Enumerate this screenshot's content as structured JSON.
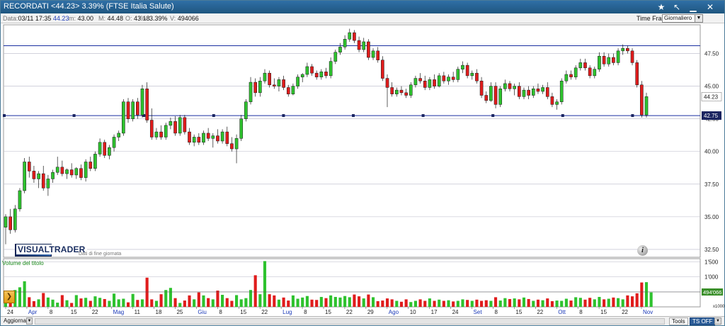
{
  "window": {
    "title": "RECORDATI <44.23> 3.39%   (FTSE Italia Salute)",
    "colors": {
      "titlebar": "#2f6fa6"
    }
  },
  "info_bar": {
    "date_label": "Data:",
    "date_value": "03/11 17:35",
    "last_value": "44.23",
    "min_label": "m:",
    "min_value": "43.00",
    "max_label": "M:",
    "max_value": "44.48",
    "open_label": "O:",
    "open_value": "43.18",
    "pct_label": "%:",
    "pct_value": "3.39%",
    "vol_label": "V:",
    "vol_value": "494066",
    "time_frame_label": "Time Frame",
    "time_frame_value": "Giornaliero"
  },
  "chart_data": {
    "type": "candlestick",
    "price_axis": {
      "range": [
        31.9,
        49.7
      ],
      "ticks": [
        "32.50",
        "35.00",
        "37.50",
        "40.00",
        "42.50",
        "45.00",
        "47.50"
      ]
    },
    "resistance_line": 48.1,
    "support_line": 42.75,
    "current_price_label": "44.23",
    "support_price_label": "42.75",
    "volume_title": "Volume del titolo",
    "volume_axis": {
      "range": [
        0,
        1600
      ],
      "ticks": [
        {
          "value": 1500,
          "label": "1'500"
        },
        {
          "value": 1000,
          "label": "1'000"
        },
        {
          "value": 500,
          "label": "500"
        }
      ],
      "unit": "x1000",
      "current_label": "494'066",
      "current_value": 494
    },
    "x_axis": {
      "labels": [
        "24",
        "Apr",
        "8",
        "15",
        "22",
        "Mag",
        "11",
        "18",
        "25",
        "Giu",
        "8",
        "15",
        "22",
        "Lug",
        "8",
        "15",
        "22",
        "29",
        "Ago",
        "10",
        "17",
        "24",
        "Set",
        "8",
        "15",
        "22",
        "Ott",
        "8",
        "15",
        "22",
        "Nov"
      ],
      "highlighted": [
        "Apr",
        "Mag",
        "Giu",
        "Lug",
        "Ago",
        "Set",
        "Ott",
        "Nov"
      ]
    },
    "colors": {
      "up": "#2ec22e",
      "down": "#e01c1c",
      "grid": "#b8b8c8",
      "level_line": "#1a2fa0"
    },
    "candles": [
      {
        "o": 34.2,
        "h": 35.2,
        "l": 32.9,
        "c": 35.0
      },
      {
        "o": 35.0,
        "h": 35.6,
        "l": 33.7,
        "c": 34.0
      },
      {
        "o": 34.0,
        "h": 35.9,
        "l": 33.8,
        "c": 35.6
      },
      {
        "o": 35.6,
        "h": 37.2,
        "l": 35.4,
        "c": 37.0
      },
      {
        "o": 37.0,
        "h": 39.5,
        "l": 36.8,
        "c": 39.2
      },
      {
        "o": 39.2,
        "h": 39.6,
        "l": 38.0,
        "c": 38.5
      },
      {
        "o": 38.5,
        "h": 38.9,
        "l": 37.6,
        "c": 37.9
      },
      {
        "o": 37.9,
        "h": 38.5,
        "l": 37.2,
        "c": 38.3
      },
      {
        "o": 38.3,
        "h": 38.9,
        "l": 37.0,
        "c": 37.2
      },
      {
        "o": 37.2,
        "h": 38.2,
        "l": 36.6,
        "c": 37.9
      },
      {
        "o": 37.9,
        "h": 38.6,
        "l": 37.6,
        "c": 38.4
      },
      {
        "o": 38.4,
        "h": 39.6,
        "l": 38.2,
        "c": 38.8
      },
      {
        "o": 38.8,
        "h": 39.3,
        "l": 38.1,
        "c": 38.3
      },
      {
        "o": 38.3,
        "h": 38.7,
        "l": 37.9,
        "c": 38.6
      },
      {
        "o": 38.6,
        "h": 39.1,
        "l": 38.0,
        "c": 38.2
      },
      {
        "o": 38.2,
        "h": 38.8,
        "l": 37.9,
        "c": 38.7
      },
      {
        "o": 38.7,
        "h": 39.0,
        "l": 37.8,
        "c": 38.0
      },
      {
        "o": 38.0,
        "h": 39.4,
        "l": 37.7,
        "c": 39.2
      },
      {
        "o": 39.2,
        "h": 39.6,
        "l": 38.5,
        "c": 38.7
      },
      {
        "o": 38.7,
        "h": 40.0,
        "l": 38.5,
        "c": 39.8
      },
      {
        "o": 39.8,
        "h": 41.0,
        "l": 39.6,
        "c": 40.7
      },
      {
        "o": 40.7,
        "h": 40.9,
        "l": 39.5,
        "c": 39.7
      },
      {
        "o": 39.7,
        "h": 40.5,
        "l": 39.4,
        "c": 40.3
      },
      {
        "o": 40.3,
        "h": 41.3,
        "l": 40.0,
        "c": 41.1
      },
      {
        "o": 41.1,
        "h": 41.6,
        "l": 40.8,
        "c": 41.4
      },
      {
        "o": 41.4,
        "h": 44.0,
        "l": 41.2,
        "c": 43.8
      },
      {
        "o": 43.8,
        "h": 44.1,
        "l": 42.2,
        "c": 42.5
      },
      {
        "o": 42.5,
        "h": 44.0,
        "l": 42.3,
        "c": 43.8
      },
      {
        "o": 43.8,
        "h": 44.1,
        "l": 42.5,
        "c": 42.8
      },
      {
        "o": 42.8,
        "h": 45.1,
        "l": 42.6,
        "c": 44.8
      },
      {
        "o": 44.8,
        "h": 45.3,
        "l": 42.2,
        "c": 42.4
      },
      {
        "o": 42.4,
        "h": 43.3,
        "l": 40.9,
        "c": 41.1
      },
      {
        "o": 41.1,
        "h": 41.8,
        "l": 40.9,
        "c": 41.5
      },
      {
        "o": 41.5,
        "h": 42.0,
        "l": 40.9,
        "c": 41.1
      },
      {
        "o": 41.1,
        "h": 42.2,
        "l": 40.9,
        "c": 42.0
      },
      {
        "o": 42.0,
        "h": 42.6,
        "l": 41.7,
        "c": 42.3
      },
      {
        "o": 42.3,
        "h": 42.7,
        "l": 41.2,
        "c": 41.4
      },
      {
        "o": 41.4,
        "h": 42.8,
        "l": 41.2,
        "c": 42.6
      },
      {
        "o": 42.6,
        "h": 42.8,
        "l": 41.3,
        "c": 41.5
      },
      {
        "o": 41.5,
        "h": 41.8,
        "l": 40.5,
        "c": 40.7
      },
      {
        "o": 40.7,
        "h": 41.3,
        "l": 40.4,
        "c": 41.1
      },
      {
        "o": 41.1,
        "h": 41.4,
        "l": 40.5,
        "c": 40.7
      },
      {
        "o": 40.7,
        "h": 41.6,
        "l": 40.5,
        "c": 41.4
      },
      {
        "o": 41.4,
        "h": 41.8,
        "l": 40.8,
        "c": 41.0
      },
      {
        "o": 41.0,
        "h": 41.4,
        "l": 40.3,
        "c": 41.2
      },
      {
        "o": 41.2,
        "h": 41.7,
        "l": 40.6,
        "c": 40.8
      },
      {
        "o": 40.8,
        "h": 41.7,
        "l": 40.6,
        "c": 41.5
      },
      {
        "o": 41.5,
        "h": 41.9,
        "l": 40.4,
        "c": 40.6
      },
      {
        "o": 40.6,
        "h": 41.1,
        "l": 40.0,
        "c": 40.2
      },
      {
        "o": 40.2,
        "h": 41.3,
        "l": 39.1,
        "c": 41.0
      },
      {
        "o": 41.0,
        "h": 42.8,
        "l": 40.8,
        "c": 42.5
      },
      {
        "o": 42.5,
        "h": 44.0,
        "l": 42.3,
        "c": 43.8
      },
      {
        "o": 43.8,
        "h": 45.7,
        "l": 43.6,
        "c": 45.3
      },
      {
        "o": 45.3,
        "h": 45.6,
        "l": 44.2,
        "c": 44.5
      },
      {
        "o": 44.5,
        "h": 45.7,
        "l": 44.2,
        "c": 45.4
      },
      {
        "o": 45.4,
        "h": 46.3,
        "l": 45.2,
        "c": 46.0
      },
      {
        "o": 46.0,
        "h": 46.2,
        "l": 44.9,
        "c": 45.1
      },
      {
        "o": 45.1,
        "h": 45.6,
        "l": 44.8,
        "c": 45.0
      },
      {
        "o": 45.0,
        "h": 45.7,
        "l": 44.6,
        "c": 45.5
      },
      {
        "o": 45.5,
        "h": 45.8,
        "l": 44.7,
        "c": 44.9
      },
      {
        "o": 44.9,
        "h": 45.1,
        "l": 44.2,
        "c": 44.4
      },
      {
        "o": 44.4,
        "h": 45.2,
        "l": 44.3,
        "c": 45.0
      },
      {
        "o": 45.0,
        "h": 45.9,
        "l": 44.8,
        "c": 45.7
      },
      {
        "o": 45.7,
        "h": 46.0,
        "l": 45.3,
        "c": 45.9
      },
      {
        "o": 45.9,
        "h": 46.8,
        "l": 45.7,
        "c": 46.5
      },
      {
        "o": 46.5,
        "h": 46.7,
        "l": 45.8,
        "c": 46.0
      },
      {
        "o": 46.0,
        "h": 46.2,
        "l": 45.5,
        "c": 45.7
      },
      {
        "o": 45.7,
        "h": 46.3,
        "l": 45.5,
        "c": 46.1
      },
      {
        "o": 46.1,
        "h": 46.4,
        "l": 45.6,
        "c": 45.8
      },
      {
        "o": 45.8,
        "h": 47.2,
        "l": 45.6,
        "c": 46.9
      },
      {
        "o": 46.9,
        "h": 47.8,
        "l": 46.7,
        "c": 47.6
      },
      {
        "o": 47.6,
        "h": 48.3,
        "l": 47.4,
        "c": 48.0
      },
      {
        "o": 48.0,
        "h": 48.9,
        "l": 47.8,
        "c": 48.6
      },
      {
        "o": 48.6,
        "h": 49.4,
        "l": 48.4,
        "c": 49.1
      },
      {
        "o": 49.1,
        "h": 49.3,
        "l": 48.3,
        "c": 48.5
      },
      {
        "o": 48.5,
        "h": 48.8,
        "l": 47.6,
        "c": 47.8
      },
      {
        "o": 47.8,
        "h": 48.7,
        "l": 47.6,
        "c": 48.4
      },
      {
        "o": 48.4,
        "h": 48.6,
        "l": 47.0,
        "c": 47.2
      },
      {
        "o": 47.2,
        "h": 47.9,
        "l": 47.0,
        "c": 47.7
      },
      {
        "o": 47.7,
        "h": 48.0,
        "l": 46.8,
        "c": 47.0
      },
      {
        "o": 47.0,
        "h": 47.3,
        "l": 45.4,
        "c": 45.6
      },
      {
        "o": 45.6,
        "h": 45.9,
        "l": 43.4,
        "c": 44.9
      },
      {
        "o": 44.9,
        "h": 45.3,
        "l": 44.2,
        "c": 44.4
      },
      {
        "o": 44.4,
        "h": 44.9,
        "l": 44.2,
        "c": 44.7
      },
      {
        "o": 44.7,
        "h": 45.0,
        "l": 44.3,
        "c": 44.5
      },
      {
        "o": 44.5,
        "h": 44.8,
        "l": 44.1,
        "c": 44.3
      },
      {
        "o": 44.3,
        "h": 45.3,
        "l": 44.1,
        "c": 45.1
      },
      {
        "o": 45.1,
        "h": 45.8,
        "l": 44.9,
        "c": 45.6
      },
      {
        "o": 45.6,
        "h": 46.0,
        "l": 45.2,
        "c": 45.4
      },
      {
        "o": 45.4,
        "h": 45.8,
        "l": 44.7,
        "c": 44.9
      },
      {
        "o": 44.9,
        "h": 45.7,
        "l": 44.7,
        "c": 45.5
      },
      {
        "o": 45.5,
        "h": 45.9,
        "l": 44.8,
        "c": 45.0
      },
      {
        "o": 45.0,
        "h": 46.0,
        "l": 44.9,
        "c": 45.8
      },
      {
        "o": 45.8,
        "h": 46.1,
        "l": 45.2,
        "c": 45.4
      },
      {
        "o": 45.4,
        "h": 45.9,
        "l": 45.1,
        "c": 45.7
      },
      {
        "o": 45.7,
        "h": 46.1,
        "l": 45.3,
        "c": 45.5
      },
      {
        "o": 45.5,
        "h": 46.5,
        "l": 45.3,
        "c": 46.3
      },
      {
        "o": 46.3,
        "h": 46.9,
        "l": 46.0,
        "c": 46.6
      },
      {
        "o": 46.6,
        "h": 46.8,
        "l": 45.6,
        "c": 45.8
      },
      {
        "o": 45.8,
        "h": 46.2,
        "l": 45.5,
        "c": 46.0
      },
      {
        "o": 46.0,
        "h": 46.3,
        "l": 45.2,
        "c": 45.4
      },
      {
        "o": 45.4,
        "h": 45.7,
        "l": 44.1,
        "c": 44.3
      },
      {
        "o": 44.3,
        "h": 44.6,
        "l": 43.7,
        "c": 43.9
      },
      {
        "o": 43.9,
        "h": 45.3,
        "l": 43.8,
        "c": 45.0
      },
      {
        "o": 45.0,
        "h": 45.3,
        "l": 43.3,
        "c": 43.6
      },
      {
        "o": 43.6,
        "h": 45.0,
        "l": 43.4,
        "c": 44.8
      },
      {
        "o": 44.8,
        "h": 45.5,
        "l": 44.6,
        "c": 45.2
      },
      {
        "o": 45.2,
        "h": 45.4,
        "l": 44.6,
        "c": 44.8
      },
      {
        "o": 44.8,
        "h": 45.2,
        "l": 44.3,
        "c": 45.0
      },
      {
        "o": 45.0,
        "h": 45.3,
        "l": 44.0,
        "c": 44.2
      },
      {
        "o": 44.2,
        "h": 44.9,
        "l": 44.0,
        "c": 44.7
      },
      {
        "o": 44.7,
        "h": 45.0,
        "l": 44.0,
        "c": 44.3
      },
      {
        "o": 44.3,
        "h": 45.0,
        "l": 44.1,
        "c": 44.8
      },
      {
        "o": 44.8,
        "h": 45.2,
        "l": 44.4,
        "c": 44.6
      },
      {
        "o": 44.6,
        "h": 45.1,
        "l": 44.4,
        "c": 44.9
      },
      {
        "o": 44.9,
        "h": 45.3,
        "l": 44.0,
        "c": 44.2
      },
      {
        "o": 44.2,
        "h": 44.5,
        "l": 43.4,
        "c": 43.6
      },
      {
        "o": 43.6,
        "h": 44.0,
        "l": 43.2,
        "c": 43.8
      },
      {
        "o": 43.8,
        "h": 45.6,
        "l": 43.6,
        "c": 45.4
      },
      {
        "o": 45.4,
        "h": 46.2,
        "l": 45.2,
        "c": 45.9
      },
      {
        "o": 45.9,
        "h": 46.2,
        "l": 45.5,
        "c": 45.7
      },
      {
        "o": 45.7,
        "h": 46.6,
        "l": 45.5,
        "c": 46.4
      },
      {
        "o": 46.4,
        "h": 47.1,
        "l": 46.2,
        "c": 46.8
      },
      {
        "o": 46.8,
        "h": 47.1,
        "l": 46.2,
        "c": 46.4
      },
      {
        "o": 46.4,
        "h": 46.6,
        "l": 45.6,
        "c": 45.8
      },
      {
        "o": 45.8,
        "h": 46.5,
        "l": 45.6,
        "c": 46.3
      },
      {
        "o": 46.3,
        "h": 47.6,
        "l": 46.1,
        "c": 47.3
      },
      {
        "o": 47.3,
        "h": 47.6,
        "l": 46.5,
        "c": 46.7
      },
      {
        "o": 46.7,
        "h": 47.5,
        "l": 46.5,
        "c": 47.2
      },
      {
        "o": 47.2,
        "h": 47.5,
        "l": 46.6,
        "c": 46.8
      },
      {
        "o": 46.8,
        "h": 47.9,
        "l": 46.6,
        "c": 47.7
      },
      {
        "o": 47.7,
        "h": 48.2,
        "l": 47.4,
        "c": 47.9
      },
      {
        "o": 47.9,
        "h": 48.1,
        "l": 47.5,
        "c": 47.7
      },
      {
        "o": 47.7,
        "h": 47.9,
        "l": 46.6,
        "c": 46.8
      },
      {
        "o": 46.8,
        "h": 47.0,
        "l": 44.9,
        "c": 45.1
      },
      {
        "o": 45.1,
        "h": 45.4,
        "l": 42.6,
        "c": 42.8
      },
      {
        "o": 42.8,
        "h": 44.5,
        "l": 42.6,
        "c": 44.2
      }
    ],
    "volumes": [
      180,
      230,
      560,
      650,
      850,
      320,
      190,
      250,
      460,
      310,
      240,
      140,
      390,
      220,
      130,
      390,
      280,
      300,
      200,
      350,
      300,
      260,
      200,
      440,
      250,
      270,
      150,
      430,
      230,
      250,
      970,
      250,
      200,
      420,
      560,
      630,
      290,
      130,
      210,
      380,
      250,
      480,
      380,
      290,
      250,
      540,
      400,
      290,
      200,
      390,
      250,
      290,
      560,
      1050,
      420,
      1520,
      420,
      380,
      240,
      310,
      210,
      380,
      270,
      310,
      360,
      240,
      230,
      330,
      290,
      380,
      330,
      310,
      360,
      320,
      410,
      350,
      280,
      410,
      320,
      190,
      210,
      280,
      250,
      200,
      170,
      250,
      160,
      200,
      250,
      200,
      280,
      200,
      240,
      200,
      220,
      180,
      200,
      250,
      230,
      200,
      240,
      200,
      220,
      200,
      320,
      210,
      290,
      260,
      280,
      250,
      310,
      260,
      200,
      240,
      220,
      280,
      190,
      210,
      200,
      270,
      210,
      320,
      300,
      240,
      300,
      250,
      330,
      250,
      270,
      310,
      290,
      250,
      380,
      350,
      450,
      810,
      820,
      480
    ]
  },
  "watermark": {
    "brand": "VISUALTRADER",
    "subtitle": "Dati di fine giornata"
  },
  "bottom_bar": {
    "refresh_label": "Aggiorna",
    "tools_label": "Tools",
    "ts_label": "TS OFF"
  }
}
